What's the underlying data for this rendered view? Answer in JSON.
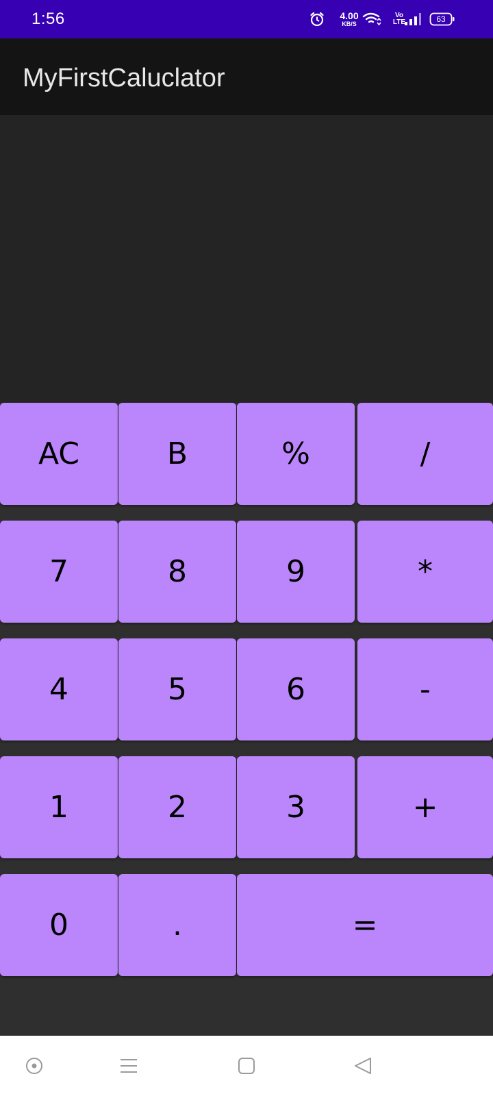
{
  "status_bar": {
    "time": "1:56",
    "net_speed_value": "4.00",
    "net_speed_unit": "KB/S",
    "volte_top": "Vo",
    "volte_bottom": "LTE",
    "battery_level": "63",
    "icons": [
      "alarm-icon",
      "wifi-icon",
      "signal-icon",
      "battery-icon"
    ]
  },
  "app_bar": {
    "title": "MyFirstCaluclator"
  },
  "display": {
    "text": ""
  },
  "keypad": {
    "keys": [
      {
        "label": "AC",
        "name": "key-ac"
      },
      {
        "label": "B",
        "name": "key-backspace"
      },
      {
        "label": "%",
        "name": "key-percent"
      },
      {
        "label": "/",
        "name": "key-divide"
      },
      {
        "label": "7",
        "name": "key-7"
      },
      {
        "label": "8",
        "name": "key-8"
      },
      {
        "label": "9",
        "name": "key-9"
      },
      {
        "label": "*",
        "name": "key-multiply"
      },
      {
        "label": "4",
        "name": "key-4"
      },
      {
        "label": "5",
        "name": "key-5"
      },
      {
        "label": "6",
        "name": "key-6"
      },
      {
        "label": "-",
        "name": "key-subtract"
      },
      {
        "label": "1",
        "name": "key-1"
      },
      {
        "label": "2",
        "name": "key-2"
      },
      {
        "label": "3",
        "name": "key-3"
      },
      {
        "label": "+",
        "name": "key-add"
      },
      {
        "label": "0",
        "name": "key-0"
      },
      {
        "label": ".",
        "name": "key-decimal"
      },
      {
        "label": "=",
        "name": "key-equals"
      }
    ]
  },
  "nav_bar": {
    "icons": [
      "assistant-icon",
      "menu-icon",
      "home-icon",
      "back-icon"
    ]
  },
  "colors": {
    "status_bar": "#3700b3",
    "app_bar": "#141414",
    "display": "#242424",
    "keypad_background": "#302f30",
    "key": "#bb86fc",
    "key_text": "#000000"
  }
}
